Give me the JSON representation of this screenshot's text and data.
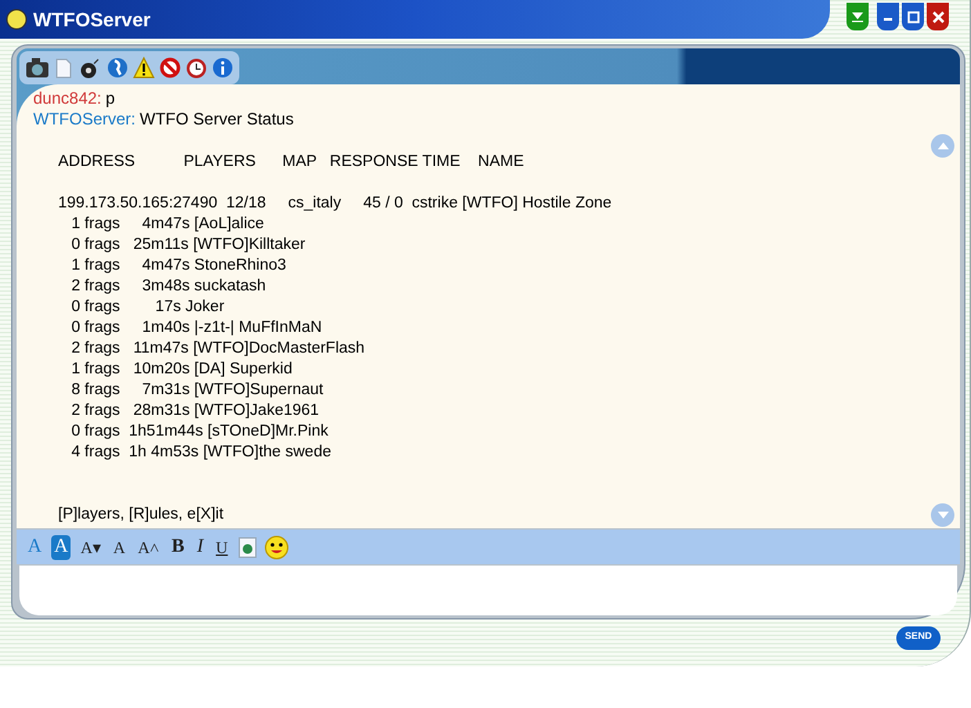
{
  "window": {
    "title": "WTFOServer"
  },
  "messages": [
    {
      "kind": "user",
      "sender": "dunc842:",
      "text": "p"
    },
    {
      "kind": "server",
      "sender": "WTFOServer:",
      "text": "WTFO Server Status"
    }
  ],
  "status_header": "ADDRESS           PLAYERS      MAP   RESPONSE TIME    NAME",
  "status_lines": [
    "199.173.50.165:27490  12/18     cs_italy     45 / 0  cstrike [WTFO] Hostile Zone",
    "   1 frags     4m47s [AoL]alice",
    "   0 frags   25m11s [WTFO]Killtaker",
    "   1 frags     4m47s StoneRhino3",
    "   2 frags     3m48s suckatash",
    "   0 frags        17s Joker",
    "   0 frags     1m40s |-z1t-| MuFfInMaN",
    "   2 frags   11m47s [WTFO]DocMasterFlash",
    "   1 frags   10m20s [DA] Superkid",
    "   8 frags     7m31s [WTFO]Supernaut",
    "   2 frags   28m31s [WTFO]Jake1961",
    "   0 frags  1h51m44s [sTOneD]Mr.Pink",
    "   4 frags  1h 4m53s [WTFO]the swede"
  ],
  "menu_line": "[P]layers, [R]ules, e[X]it",
  "format_buttons": [
    {
      "kind": "color",
      "label": "A",
      "selected": false
    },
    {
      "kind": "color",
      "label": "A",
      "selected": true
    },
    {
      "kind": "size",
      "label": "A▾",
      "selected": false
    },
    {
      "kind": "size",
      "label": "A",
      "selected": false
    },
    {
      "kind": "size",
      "label": "A˄",
      "selected": false
    },
    {
      "kind": "bold",
      "label": "B",
      "selected": false
    },
    {
      "kind": "italic",
      "label": "I",
      "selected": false
    },
    {
      "kind": "underline",
      "label": "U",
      "selected": false
    }
  ],
  "send_button": "SEND"
}
